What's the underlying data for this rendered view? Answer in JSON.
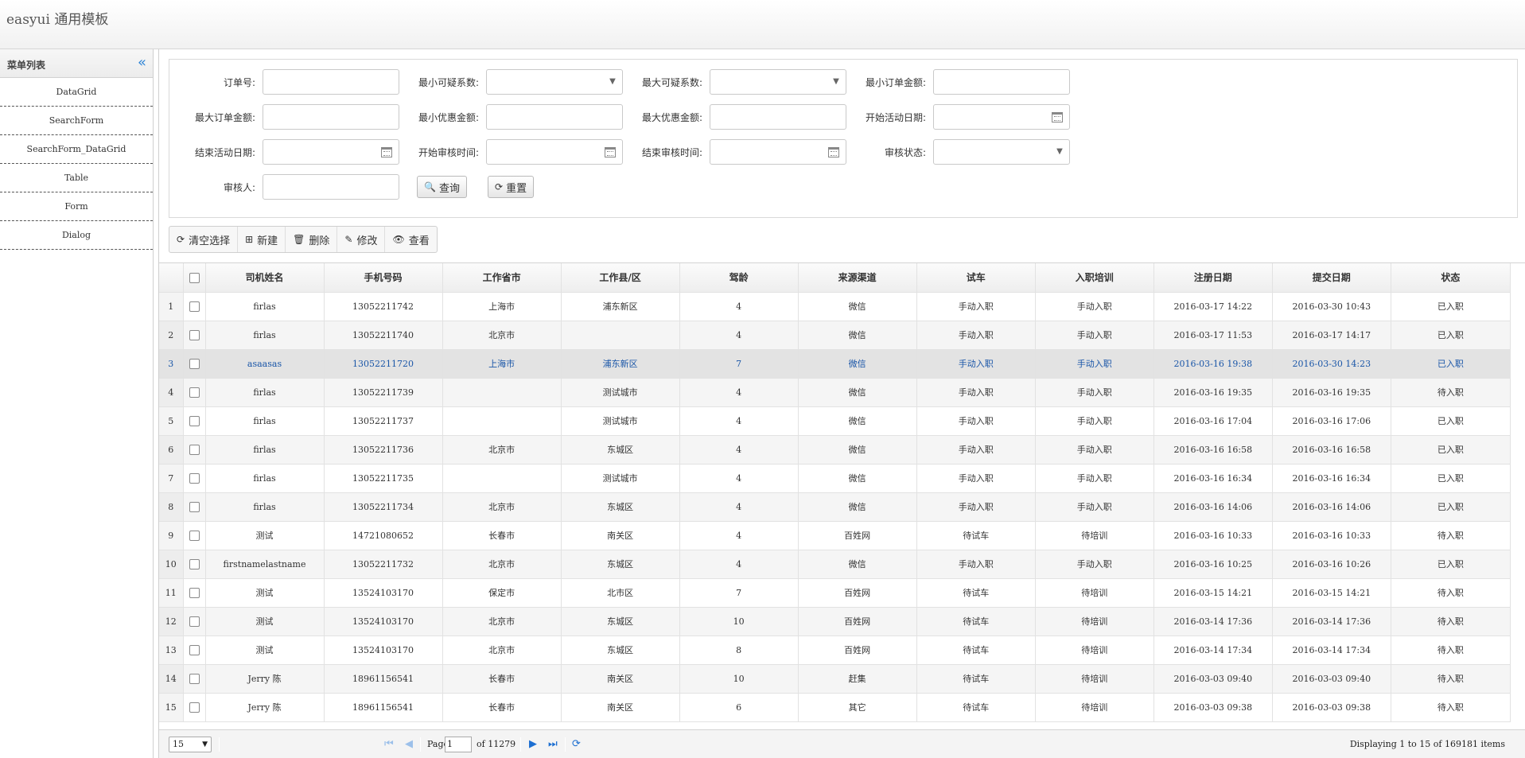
{
  "app": {
    "title": "easyui 通用模板"
  },
  "sidebar": {
    "title": "菜单列表",
    "collapse_glyph": "«",
    "items": [
      {
        "label": "DataGrid"
      },
      {
        "label": "SearchForm"
      },
      {
        "label": "SearchForm_DataGrid"
      },
      {
        "label": "Table"
      },
      {
        "label": "Form"
      },
      {
        "label": "Dialog"
      }
    ]
  },
  "search": {
    "labels": {
      "order_no": "订单号:",
      "min_suspect": "最小可疑系数:",
      "max_suspect": "最大可疑系数:",
      "min_order_amount": "最小订单金额:",
      "max_order_amount": "最大订单金额:",
      "min_discount": "最小优惠金额:",
      "max_discount": "最大优惠金额:",
      "start_activity_date": "开始活动日期:",
      "end_activity_date": "结束活动日期:",
      "start_audit_time": "开始审核时间:",
      "end_audit_time": "结束审核时间:",
      "audit_status": "审核状态:",
      "auditor": "审核人:"
    },
    "query_label": "查询",
    "reset_label": "重置"
  },
  "toolbar": {
    "clear_label": "清空选择",
    "new_label": "新建",
    "delete_label": "删除",
    "edit_label": "修改",
    "view_label": "查看"
  },
  "grid": {
    "columns": [
      "司机姓名",
      "手机号码",
      "工作省市",
      "工作县/区",
      "驾龄",
      "来源渠道",
      "试车",
      "入职培训",
      "注册日期",
      "提交日期",
      "状态"
    ],
    "selected_row": 3,
    "rows": [
      [
        "firlas",
        "13052211742",
        "上海市",
        "浦东新区",
        "4",
        "微信",
        "手动入职",
        "手动入职",
        "2016-03-17 14:22",
        "2016-03-30 10:43",
        "已入职"
      ],
      [
        "firlas",
        "13052211740",
        "北京市",
        "",
        "4",
        "微信",
        "手动入职",
        "手动入职",
        "2016-03-17 11:53",
        "2016-03-17 14:17",
        "已入职"
      ],
      [
        "asaasas",
        "13052211720",
        "上海市",
        "浦东新区",
        "7",
        "微信",
        "手动入职",
        "手动入职",
        "2016-03-16 19:38",
        "2016-03-30 14:23",
        "已入职"
      ],
      [
        "firlas",
        "13052211739",
        "",
        "测试城市",
        "4",
        "微信",
        "手动入职",
        "手动入职",
        "2016-03-16 19:35",
        "2016-03-16 19:35",
        "待入职"
      ],
      [
        "firlas",
        "13052211737",
        "",
        "测试城市",
        "4",
        "微信",
        "手动入职",
        "手动入职",
        "2016-03-16 17:04",
        "2016-03-16 17:06",
        "已入职"
      ],
      [
        "firlas",
        "13052211736",
        "北京市",
        "东城区",
        "4",
        "微信",
        "手动入职",
        "手动入职",
        "2016-03-16 16:58",
        "2016-03-16 16:58",
        "已入职"
      ],
      [
        "firlas",
        "13052211735",
        "",
        "测试城市",
        "4",
        "微信",
        "手动入职",
        "手动入职",
        "2016-03-16 16:34",
        "2016-03-16 16:34",
        "已入职"
      ],
      [
        "firlas",
        "13052211734",
        "北京市",
        "东城区",
        "4",
        "微信",
        "手动入职",
        "手动入职",
        "2016-03-16 14:06",
        "2016-03-16 14:06",
        "已入职"
      ],
      [
        "测试",
        "14721080652",
        "长春市",
        "南关区",
        "4",
        "百姓网",
        "待试车",
        "待培训",
        "2016-03-16 10:33",
        "2016-03-16 10:33",
        "待入职"
      ],
      [
        "firstnamelastname",
        "13052211732",
        "北京市",
        "东城区",
        "4",
        "微信",
        "手动入职",
        "手动入职",
        "2016-03-16 10:25",
        "2016-03-16 10:26",
        "已入职"
      ],
      [
        "测试",
        "13524103170",
        "保定市",
        "北市区",
        "7",
        "百姓网",
        "待试车",
        "待培训",
        "2016-03-15 14:21",
        "2016-03-15 14:21",
        "待入职"
      ],
      [
        "测试",
        "13524103170",
        "北京市",
        "东城区",
        "10",
        "百姓网",
        "待试车",
        "待培训",
        "2016-03-14 17:36",
        "2016-03-14 17:36",
        "待入职"
      ],
      [
        "测试",
        "13524103170",
        "北京市",
        "东城区",
        "8",
        "百姓网",
        "待试车",
        "待培训",
        "2016-03-14 17:34",
        "2016-03-14 17:34",
        "待入职"
      ],
      [
        "Jerry 陈",
        "18961156541",
        "长春市",
        "南关区",
        "10",
        "赶集",
        "待试车",
        "待培训",
        "2016-03-03 09:40",
        "2016-03-03 09:40",
        "待入职"
      ],
      [
        "Jerry 陈",
        "18961156541",
        "长春市",
        "南关区",
        "6",
        "其它",
        "待试车",
        "待培训",
        "2016-03-03 09:38",
        "2016-03-03 09:38",
        "待入职"
      ]
    ]
  },
  "pager": {
    "page_size": "15",
    "page_label": "Page",
    "page_value": "1",
    "of_label": "of 11279",
    "info": "Displaying 1 to 15 of 169181 items"
  }
}
